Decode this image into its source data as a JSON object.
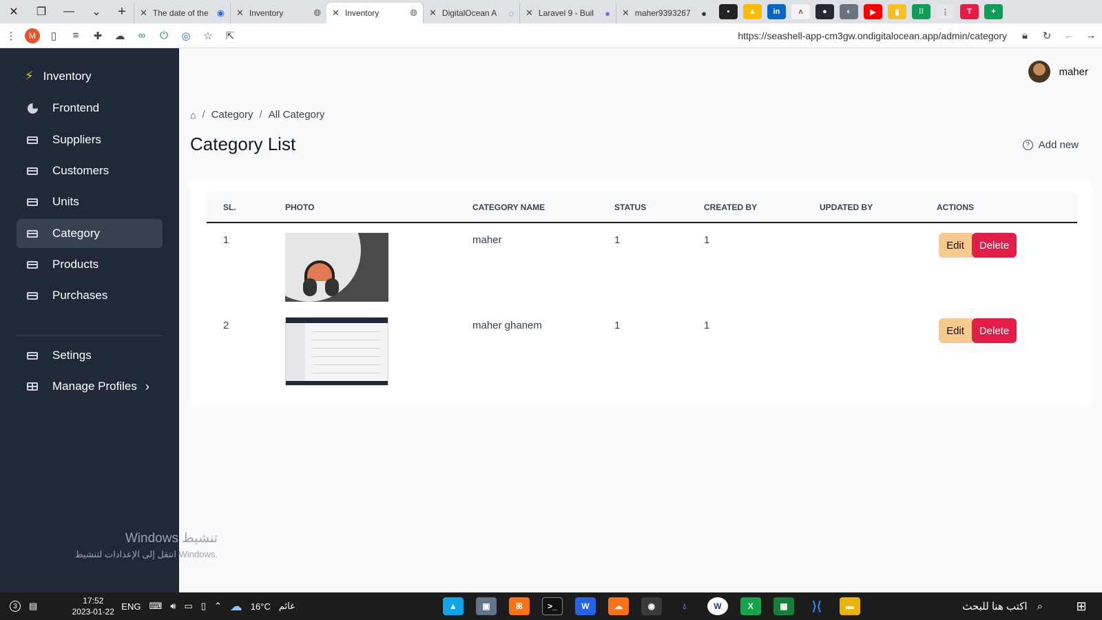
{
  "browser": {
    "tabs": [
      {
        "label": "The date of the"
      },
      {
        "label": "Inventory"
      },
      {
        "label": "Inventory",
        "active": true
      },
      {
        "label": "DigitalOcean A"
      },
      {
        "label": "Laravel 9 - Buil"
      },
      {
        "label": "maher9393267"
      }
    ],
    "profile_letter": "M",
    "url": "https://seashell-app-cm3gw.ondigitalocean.app/admin/category"
  },
  "sidebar": {
    "brand": "Inventory",
    "items": [
      {
        "label": "Frontend",
        "icon": "pie-chart-icon"
      },
      {
        "label": "Suppliers",
        "icon": "card-icon"
      },
      {
        "label": "Customers",
        "icon": "card-icon"
      },
      {
        "label": "Units",
        "icon": "card-icon"
      },
      {
        "label": "Category",
        "icon": "card-icon",
        "active": true
      },
      {
        "label": "Products",
        "icon": "card-icon"
      },
      {
        "label": "Purchases",
        "icon": "card-icon"
      },
      {
        "label": "Setings",
        "icon": "card-icon"
      },
      {
        "label": "Manage Profiles",
        "icon": "table-icon"
      }
    ]
  },
  "watermark": {
    "line1": "Windows تنشيط",
    "line2": "انتقل إلى الإعدادات لتنشيط Windows."
  },
  "header": {
    "username": "maher"
  },
  "breadcrumb": {
    "level1": "Category",
    "level2": "All Category"
  },
  "page": {
    "title": "Category List",
    "add_new": "Add new"
  },
  "table": {
    "headers": {
      "sl": "SL.",
      "photo": "PHOTO",
      "name": "CATEGORY NAME",
      "status": "STATUS",
      "created_by": "CREATED BY",
      "updated_by": "UPDATED BY",
      "actions": "ACTIONS"
    },
    "rows": [
      {
        "sl": "1",
        "name": "maher",
        "status": "1",
        "created_by": "1",
        "updated_by": "",
        "edit": "Edit",
        "delete": "Delete"
      },
      {
        "sl": "2",
        "name": "maher ghanem",
        "status": "1",
        "created_by": "1",
        "updated_by": "",
        "edit": "Edit",
        "delete": "Delete"
      }
    ]
  },
  "taskbar": {
    "notif_count": "3",
    "time": "17:52",
    "date": "2023-01-22",
    "lang": "ENG",
    "temperature": "16°C",
    "weather": "غائم",
    "search_placeholder": "اكتب هنا للبحث"
  }
}
